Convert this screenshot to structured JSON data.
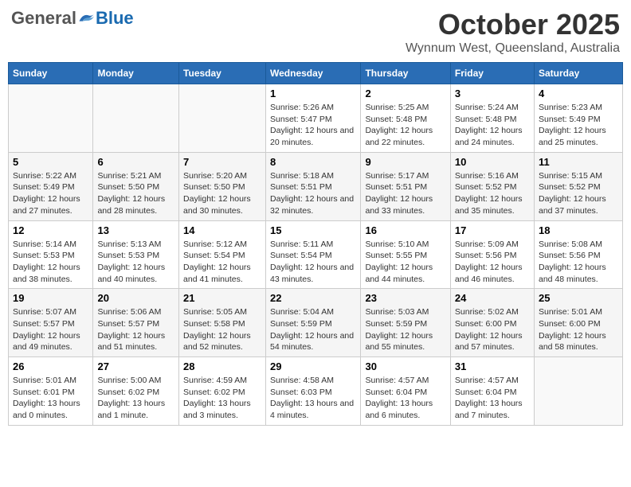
{
  "logo": {
    "general": "General",
    "blue": "Blue"
  },
  "title": "October 2025",
  "subtitle": "Wynnum West, Queensland, Australia",
  "weekdays": [
    "Sunday",
    "Monday",
    "Tuesday",
    "Wednesday",
    "Thursday",
    "Friday",
    "Saturday"
  ],
  "weeks": [
    [
      {
        "day": "",
        "sunrise": "",
        "sunset": "",
        "daylight": ""
      },
      {
        "day": "",
        "sunrise": "",
        "sunset": "",
        "daylight": ""
      },
      {
        "day": "",
        "sunrise": "",
        "sunset": "",
        "daylight": ""
      },
      {
        "day": "1",
        "sunrise": "Sunrise: 5:26 AM",
        "sunset": "Sunset: 5:47 PM",
        "daylight": "Daylight: 12 hours and 20 minutes."
      },
      {
        "day": "2",
        "sunrise": "Sunrise: 5:25 AM",
        "sunset": "Sunset: 5:48 PM",
        "daylight": "Daylight: 12 hours and 22 minutes."
      },
      {
        "day": "3",
        "sunrise": "Sunrise: 5:24 AM",
        "sunset": "Sunset: 5:48 PM",
        "daylight": "Daylight: 12 hours and 24 minutes."
      },
      {
        "day": "4",
        "sunrise": "Sunrise: 5:23 AM",
        "sunset": "Sunset: 5:49 PM",
        "daylight": "Daylight: 12 hours and 25 minutes."
      }
    ],
    [
      {
        "day": "5",
        "sunrise": "Sunrise: 5:22 AM",
        "sunset": "Sunset: 5:49 PM",
        "daylight": "Daylight: 12 hours and 27 minutes."
      },
      {
        "day": "6",
        "sunrise": "Sunrise: 5:21 AM",
        "sunset": "Sunset: 5:50 PM",
        "daylight": "Daylight: 12 hours and 28 minutes."
      },
      {
        "day": "7",
        "sunrise": "Sunrise: 5:20 AM",
        "sunset": "Sunset: 5:50 PM",
        "daylight": "Daylight: 12 hours and 30 minutes."
      },
      {
        "day": "8",
        "sunrise": "Sunrise: 5:18 AM",
        "sunset": "Sunset: 5:51 PM",
        "daylight": "Daylight: 12 hours and 32 minutes."
      },
      {
        "day": "9",
        "sunrise": "Sunrise: 5:17 AM",
        "sunset": "Sunset: 5:51 PM",
        "daylight": "Daylight: 12 hours and 33 minutes."
      },
      {
        "day": "10",
        "sunrise": "Sunrise: 5:16 AM",
        "sunset": "Sunset: 5:52 PM",
        "daylight": "Daylight: 12 hours and 35 minutes."
      },
      {
        "day": "11",
        "sunrise": "Sunrise: 5:15 AM",
        "sunset": "Sunset: 5:52 PM",
        "daylight": "Daylight: 12 hours and 37 minutes."
      }
    ],
    [
      {
        "day": "12",
        "sunrise": "Sunrise: 5:14 AM",
        "sunset": "Sunset: 5:53 PM",
        "daylight": "Daylight: 12 hours and 38 minutes."
      },
      {
        "day": "13",
        "sunrise": "Sunrise: 5:13 AM",
        "sunset": "Sunset: 5:53 PM",
        "daylight": "Daylight: 12 hours and 40 minutes."
      },
      {
        "day": "14",
        "sunrise": "Sunrise: 5:12 AM",
        "sunset": "Sunset: 5:54 PM",
        "daylight": "Daylight: 12 hours and 41 minutes."
      },
      {
        "day": "15",
        "sunrise": "Sunrise: 5:11 AM",
        "sunset": "Sunset: 5:54 PM",
        "daylight": "Daylight: 12 hours and 43 minutes."
      },
      {
        "day": "16",
        "sunrise": "Sunrise: 5:10 AM",
        "sunset": "Sunset: 5:55 PM",
        "daylight": "Daylight: 12 hours and 44 minutes."
      },
      {
        "day": "17",
        "sunrise": "Sunrise: 5:09 AM",
        "sunset": "Sunset: 5:56 PM",
        "daylight": "Daylight: 12 hours and 46 minutes."
      },
      {
        "day": "18",
        "sunrise": "Sunrise: 5:08 AM",
        "sunset": "Sunset: 5:56 PM",
        "daylight": "Daylight: 12 hours and 48 minutes."
      }
    ],
    [
      {
        "day": "19",
        "sunrise": "Sunrise: 5:07 AM",
        "sunset": "Sunset: 5:57 PM",
        "daylight": "Daylight: 12 hours and 49 minutes."
      },
      {
        "day": "20",
        "sunrise": "Sunrise: 5:06 AM",
        "sunset": "Sunset: 5:57 PM",
        "daylight": "Daylight: 12 hours and 51 minutes."
      },
      {
        "day": "21",
        "sunrise": "Sunrise: 5:05 AM",
        "sunset": "Sunset: 5:58 PM",
        "daylight": "Daylight: 12 hours and 52 minutes."
      },
      {
        "day": "22",
        "sunrise": "Sunrise: 5:04 AM",
        "sunset": "Sunset: 5:59 PM",
        "daylight": "Daylight: 12 hours and 54 minutes."
      },
      {
        "day": "23",
        "sunrise": "Sunrise: 5:03 AM",
        "sunset": "Sunset: 5:59 PM",
        "daylight": "Daylight: 12 hours and 55 minutes."
      },
      {
        "day": "24",
        "sunrise": "Sunrise: 5:02 AM",
        "sunset": "Sunset: 6:00 PM",
        "daylight": "Daylight: 12 hours and 57 minutes."
      },
      {
        "day": "25",
        "sunrise": "Sunrise: 5:01 AM",
        "sunset": "Sunset: 6:00 PM",
        "daylight": "Daylight: 12 hours and 58 minutes."
      }
    ],
    [
      {
        "day": "26",
        "sunrise": "Sunrise: 5:01 AM",
        "sunset": "Sunset: 6:01 PM",
        "daylight": "Daylight: 13 hours and 0 minutes."
      },
      {
        "day": "27",
        "sunrise": "Sunrise: 5:00 AM",
        "sunset": "Sunset: 6:02 PM",
        "daylight": "Daylight: 13 hours and 1 minute."
      },
      {
        "day": "28",
        "sunrise": "Sunrise: 4:59 AM",
        "sunset": "Sunset: 6:02 PM",
        "daylight": "Daylight: 13 hours and 3 minutes."
      },
      {
        "day": "29",
        "sunrise": "Sunrise: 4:58 AM",
        "sunset": "Sunset: 6:03 PM",
        "daylight": "Daylight: 13 hours and 4 minutes."
      },
      {
        "day": "30",
        "sunrise": "Sunrise: 4:57 AM",
        "sunset": "Sunset: 6:04 PM",
        "daylight": "Daylight: 13 hours and 6 minutes."
      },
      {
        "day": "31",
        "sunrise": "Sunrise: 4:57 AM",
        "sunset": "Sunset: 6:04 PM",
        "daylight": "Daylight: 13 hours and 7 minutes."
      },
      {
        "day": "",
        "sunrise": "",
        "sunset": "",
        "daylight": ""
      }
    ]
  ]
}
